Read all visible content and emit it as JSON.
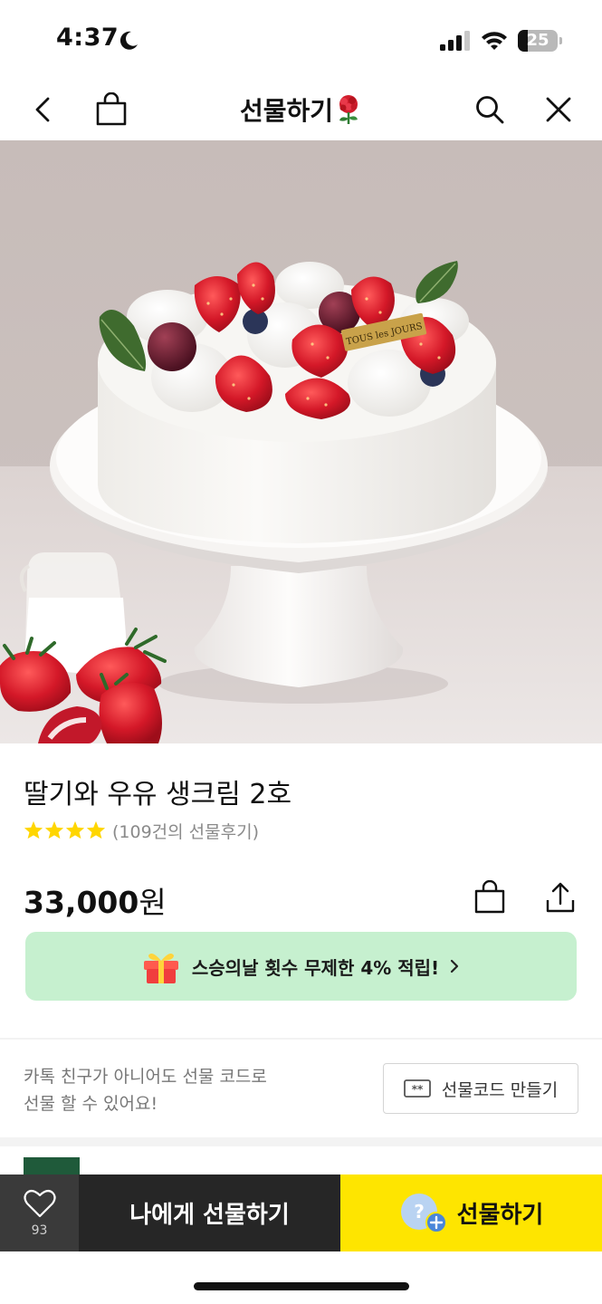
{
  "status_bar": {
    "time": "4:37",
    "battery_level": "25",
    "battery_fraction": 0.25
  },
  "nav": {
    "title": "선물하기",
    "back_icon": "chevron-left-icon",
    "bag_icon": "shopping-bag-icon",
    "search_icon": "search-icon",
    "close_icon": "close-icon",
    "title_icon": "rose-icon"
  },
  "product": {
    "name": "딸기와 우유 생크림 2호",
    "rating_stars": 4,
    "review_count_text": "(109건의 선물후기)",
    "price_number": "33,000",
    "price_unit": "원",
    "brand_tag": "TOUS les JOURS"
  },
  "promo": {
    "text": "스승의날 횟수 무제한 4% 적립!",
    "icon": "gift-box-icon",
    "color": "#c6f0cf"
  },
  "gift_code": {
    "description_line1": "카톡 친구가 아니어도 선물 코드로",
    "description_line2": "선물 할 수 있어요!",
    "button_label": "선물코드 만들기",
    "button_icon": "code-icon"
  },
  "bottom_bar": {
    "wish_count": "93",
    "wish_icon": "heart-icon",
    "self_gift_label": "나에게 선물하기",
    "gift_label": "선물하기",
    "gift_icon": "friend-add-icon",
    "accent_color": "#fee500"
  }
}
